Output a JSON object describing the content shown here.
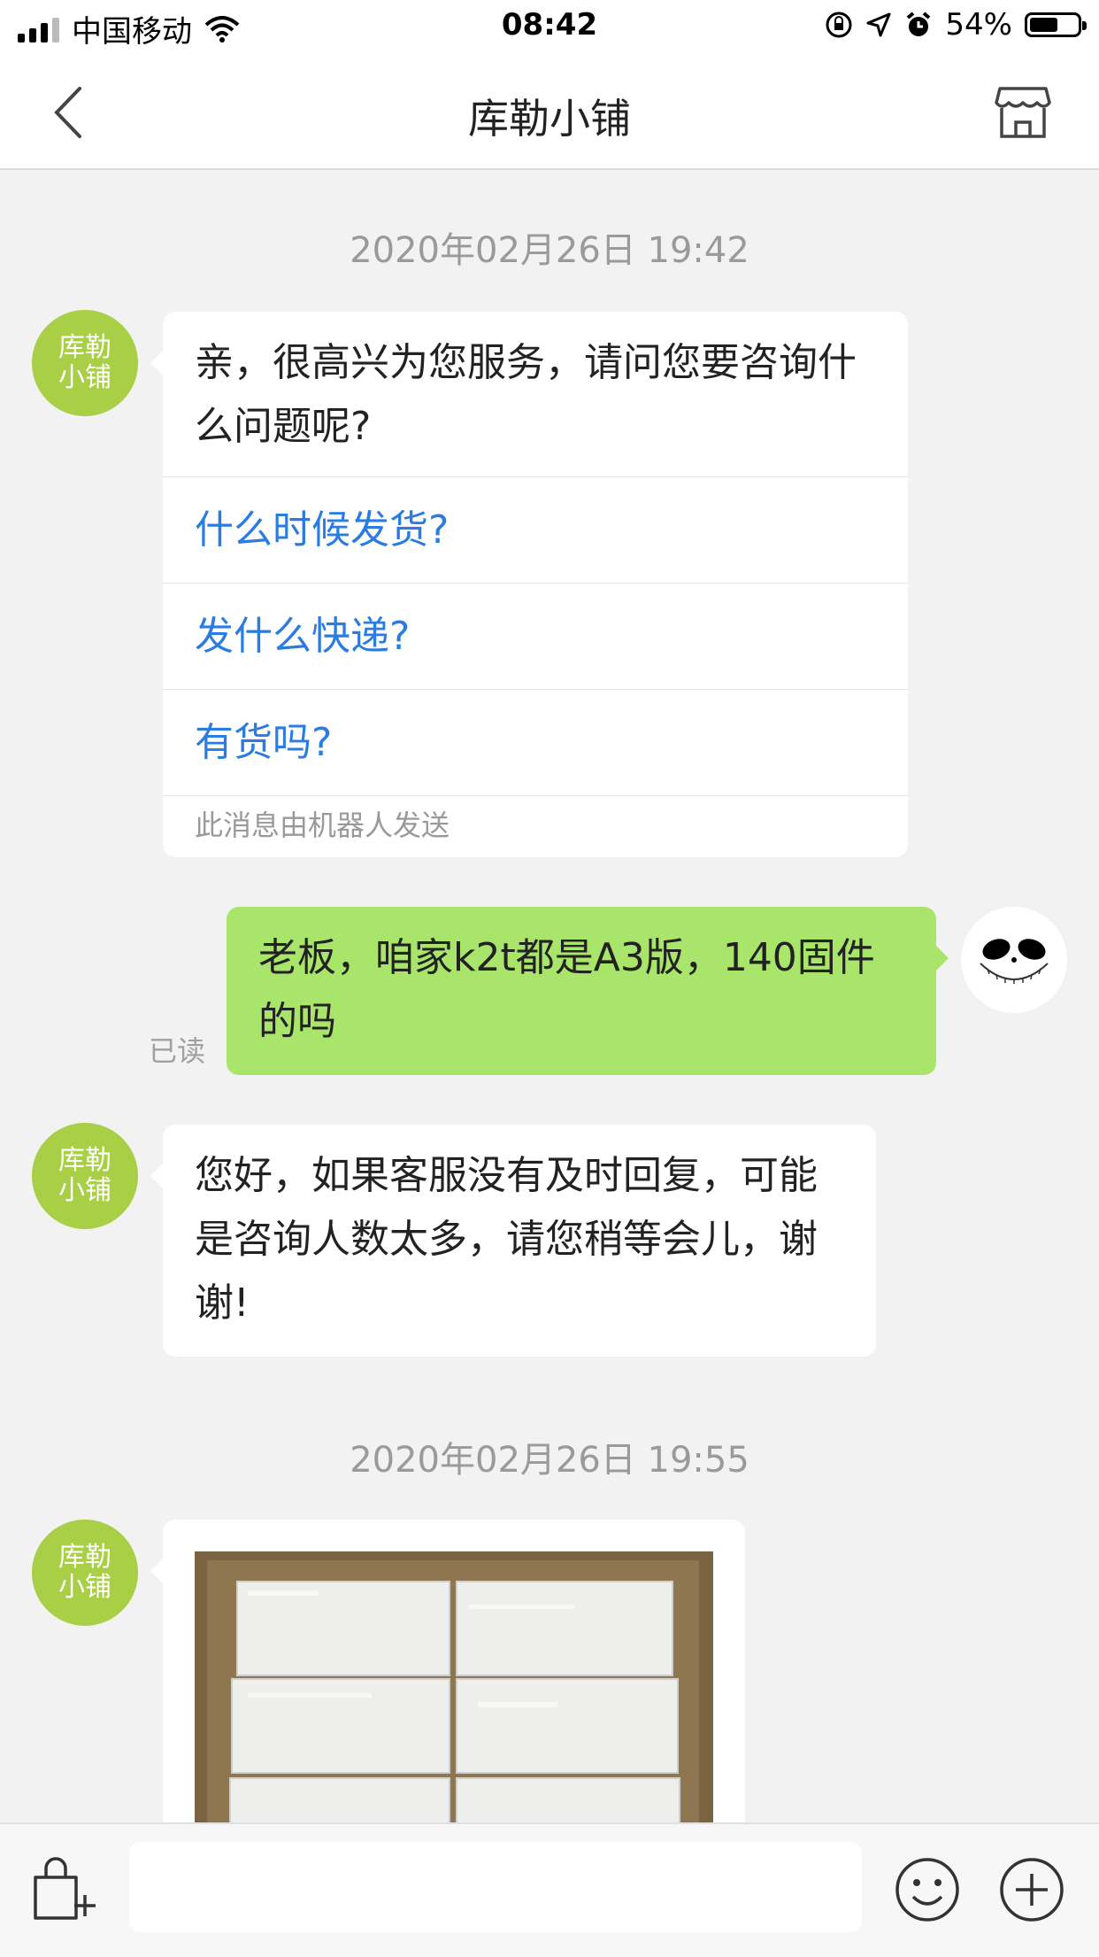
{
  "status_bar": {
    "carrier": "中国移动",
    "time": "08:42",
    "battery": "54%"
  },
  "nav": {
    "title": "库勒小铺",
    "back_icon": "chevron-left-icon",
    "store_icon": "store-icon"
  },
  "messages": {
    "timestamp1": "2020年02月26日 19:42",
    "avatar_label_line1": "库勒",
    "avatar_label_line2": "小铺",
    "bot_greeting": "亲，很高兴为您服务，请问您要咨询什么问题呢?",
    "quick_questions": [
      "什么时候发货?",
      "发什么快递?",
      "有货吗?"
    ],
    "robot_note": "此消息由机器人发送",
    "user_message": "老板，咱家k2t都是A3版，140固件的吗",
    "read_status": "已读",
    "auto_reply": "您好，如果客服没有及时回复，可能是咨询人数太多，请您稍等会儿，谢谢!",
    "timestamp2": "2020年02月26日 19:55"
  },
  "bottom": {
    "input_placeholder": "",
    "bag_icon": "shopping-bag-add-icon",
    "emoji_icon": "emoji-icon",
    "plus_icon": "plus-circle-icon"
  },
  "colors": {
    "shop_avatar": "#a8cf45",
    "user_bubble": "#a9e56b",
    "link": "#2a7ce0"
  }
}
